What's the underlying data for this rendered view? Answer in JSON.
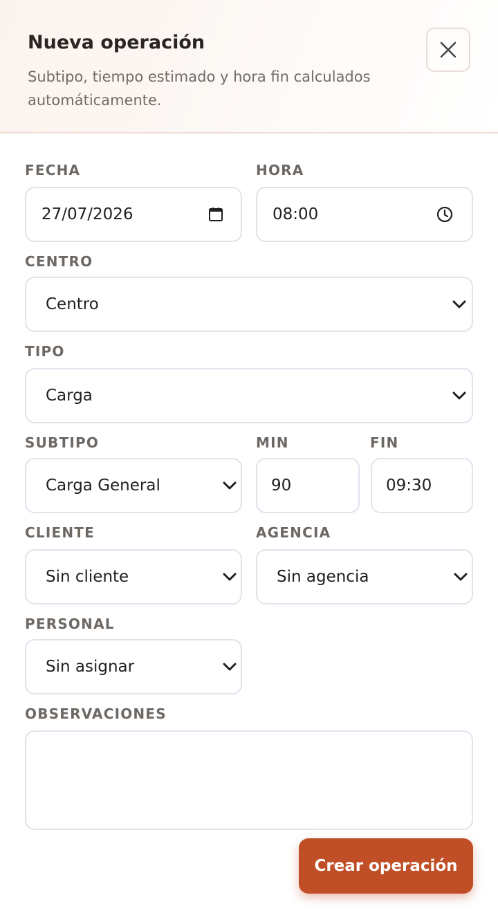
{
  "header": {
    "title": "Nueva operación",
    "subtitle": "Subtipo, tiempo estimado y hora fin calculados automáticamente."
  },
  "fields": {
    "fecha": {
      "label": "FECHA",
      "value": "27/07/2026"
    },
    "hora": {
      "label": "HORA",
      "value": "08:00"
    },
    "centro": {
      "label": "CENTRO",
      "value": "Centro"
    },
    "tipo": {
      "label": "TIPO",
      "value": "Carga"
    },
    "subtipo": {
      "label": "SUBTIPO",
      "value": "Carga General"
    },
    "min": {
      "label": "MIN",
      "value": "90"
    },
    "fin": {
      "label": "FIN",
      "value": "09:30"
    },
    "cliente": {
      "label": "CLIENTE",
      "value": "Sin cliente"
    },
    "agencia": {
      "label": "AGENCIA",
      "value": "Sin agencia"
    },
    "personal": {
      "label": "PERSONAL",
      "value": "Sin asignar"
    },
    "observaciones": {
      "label": "OBSERVACIONES",
      "value": ""
    }
  },
  "actions": {
    "submit_label": "Crear operación"
  },
  "colors": {
    "accent": "#c04e26",
    "border": "#dfe4ec"
  },
  "icons": [
    "close-icon",
    "calendar-icon",
    "clock-icon",
    "chevron-down-icon"
  ]
}
